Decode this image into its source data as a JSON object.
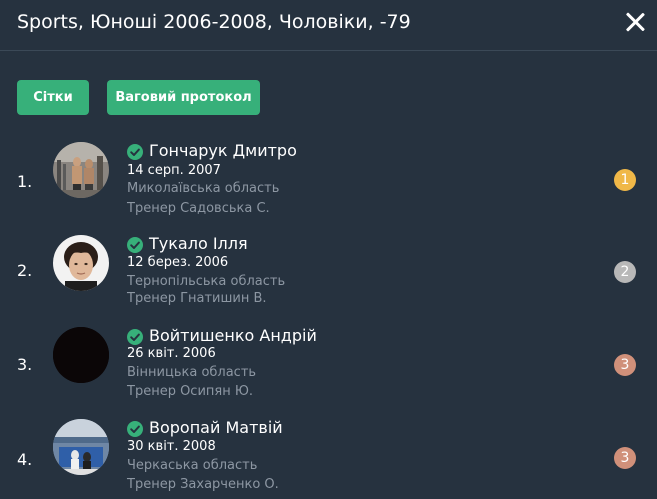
{
  "header": {
    "title": "Sports, Юноші 2006-2008, Чоловіки, -79"
  },
  "buttons": {
    "grids_label": "Сітки",
    "weigh_label": "Ваговий протокол"
  },
  "colors": {
    "background": "#26323f",
    "accent": "#37b07a",
    "muted_text": "#8d97a3",
    "gold": "#f0b848",
    "silver": "#b8b8b8",
    "bronze": "#d0907a"
  },
  "entries": [
    {
      "place": "1.",
      "name": "Гончарук Дмитро",
      "dob": "14 серп. 2007",
      "region": "Миколаївська область",
      "coach": "Тренер Садовська С.",
      "medal": "1",
      "verified_icon": "check-circle-icon"
    },
    {
      "place": "2.",
      "name": "Тукало Ілля",
      "dob": "12 берез. 2006",
      "region": "Тернопільська область",
      "coach": "Тренер Гнатишин В.",
      "medal": "2",
      "verified_icon": "check-circle-icon"
    },
    {
      "place": "3.",
      "name": "Войтишенко Андрій",
      "dob": "26 квіт. 2006",
      "region": "Вінницька область",
      "coach": "Тренер Осипян Ю.",
      "medal": "3",
      "verified_icon": "check-circle-icon"
    },
    {
      "place": "4.",
      "name": "Воропай Матвій",
      "dob": "30 квіт. 2008",
      "region": "Черкаська область",
      "coach": "Тренер Захарченко О.",
      "medal": "3",
      "verified_icon": "check-circle-icon"
    }
  ]
}
